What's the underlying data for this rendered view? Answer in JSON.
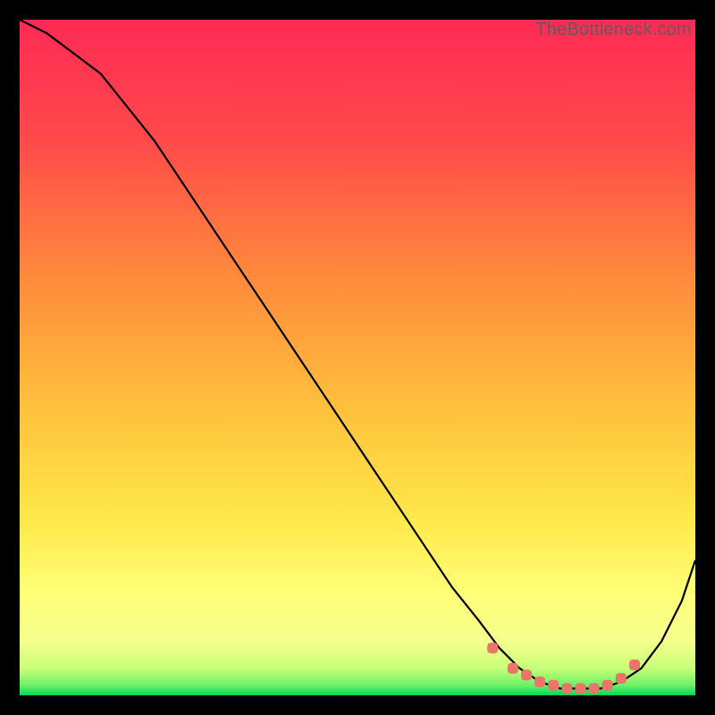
{
  "watermark": "TheBottleneck.com",
  "colors": {
    "frame": "#000000",
    "gradient_top": "#ff2a55",
    "gradient_mid1": "#ff7a3c",
    "gradient_mid2": "#ffd83c",
    "gradient_mid3": "#ffff66",
    "gradient_bottom": "#00e060",
    "curve": "#000000",
    "marker": "#e9756b"
  },
  "chart_data": {
    "type": "line",
    "title": "",
    "xlabel": "",
    "ylabel": "",
    "xlim": [
      0,
      100
    ],
    "ylim": [
      0,
      100
    ],
    "series": [
      {
        "name": "bottleneck-curve",
        "x": [
          0,
          4,
          8,
          12,
          16,
          20,
          24,
          28,
          32,
          36,
          40,
          44,
          48,
          52,
          56,
          60,
          64,
          68,
          71,
          74,
          77,
          80,
          83,
          86,
          89,
          92,
          95,
          98,
          100
        ],
        "y": [
          100,
          98,
          95,
          92,
          87,
          82,
          76,
          70,
          64,
          58,
          52,
          46,
          40,
          34,
          28,
          22,
          16,
          11,
          7,
          4,
          2,
          1,
          1,
          1,
          2,
          4,
          8,
          14,
          20
        ]
      }
    ],
    "markers": {
      "name": "optimal-range",
      "x": [
        70,
        73,
        75,
        77,
        79,
        81,
        83,
        85,
        87,
        89,
        91
      ],
      "y": [
        7,
        4,
        3,
        2,
        1.5,
        1,
        1,
        1,
        1.5,
        2.5,
        4.5
      ]
    }
  }
}
